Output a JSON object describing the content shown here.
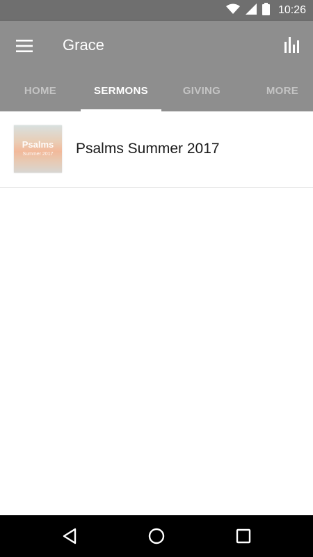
{
  "status_bar": {
    "time": "10:26",
    "icons": [
      "wifi-icon",
      "signal-icon",
      "battery-icon"
    ]
  },
  "app_bar": {
    "title": "Grace",
    "menu_icon": "hamburger-menu-icon",
    "action_icon": "bar-chart-icon"
  },
  "tabs": [
    {
      "label": "HOME",
      "active": false
    },
    {
      "label": "SERMONS",
      "active": true
    },
    {
      "label": "GIVING",
      "active": false
    },
    {
      "label": "MORE",
      "active": false
    }
  ],
  "sermon_list": [
    {
      "title": "Psalms Summer 2017",
      "thumbnail": {
        "title": "Psalms",
        "subtitle": "Summer 2017"
      }
    }
  ],
  "nav_bar": {
    "icons": [
      "back-icon",
      "home-icon",
      "recents-icon"
    ]
  },
  "colors": {
    "status_bar": "#6f6f6f",
    "app_bar": "#8e8e8e",
    "tab_inactive": "#c4c4c4",
    "tab_active": "#ffffff",
    "nav_bar": "#000000"
  }
}
